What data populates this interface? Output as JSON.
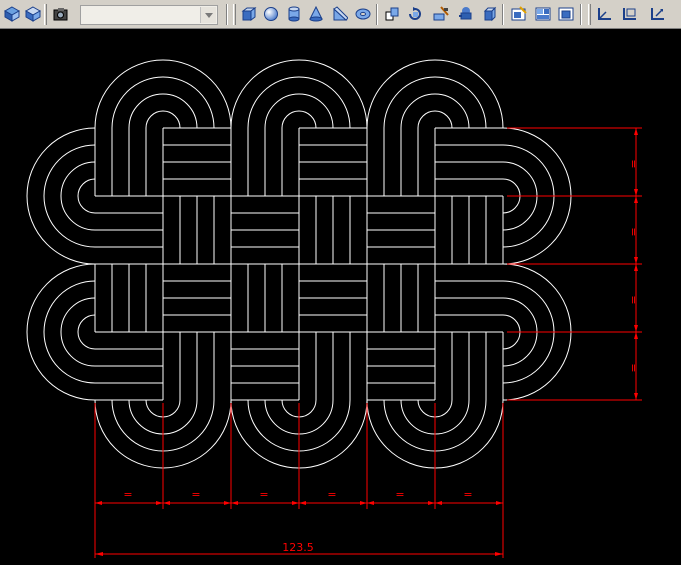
{
  "toolbar": {
    "view_combo_value": "",
    "buttons_group1": [
      "visual-style-icon",
      "shade-icon",
      "render-icon"
    ],
    "buttons_modeling": [
      "box-icon",
      "sphere-icon",
      "cylinder-icon",
      "cone-icon",
      "wedge-icon",
      "torus-icon"
    ],
    "buttons_edit": [
      "extrude-icon",
      "revolve-icon",
      "slice-icon",
      "union-icon",
      "solid-edit-icon"
    ],
    "buttons_view": [
      "named-views-icon",
      "viewports-icon",
      "view-3d-icon"
    ],
    "buttons_ucs": [
      "ucs-icon",
      "ucs-world-icon",
      "ucs-previous-icon"
    ]
  },
  "drawing": {
    "line_color": "#ffffff",
    "dimension_color": "#ff0000",
    "vertical_dimension_labels": [
      "=",
      "=",
      "=",
      "="
    ],
    "horizontal_dimension_labels": [
      "=",
      "=",
      "=",
      "=",
      "=",
      "="
    ],
    "overall_dimension_label": "123.5"
  }
}
